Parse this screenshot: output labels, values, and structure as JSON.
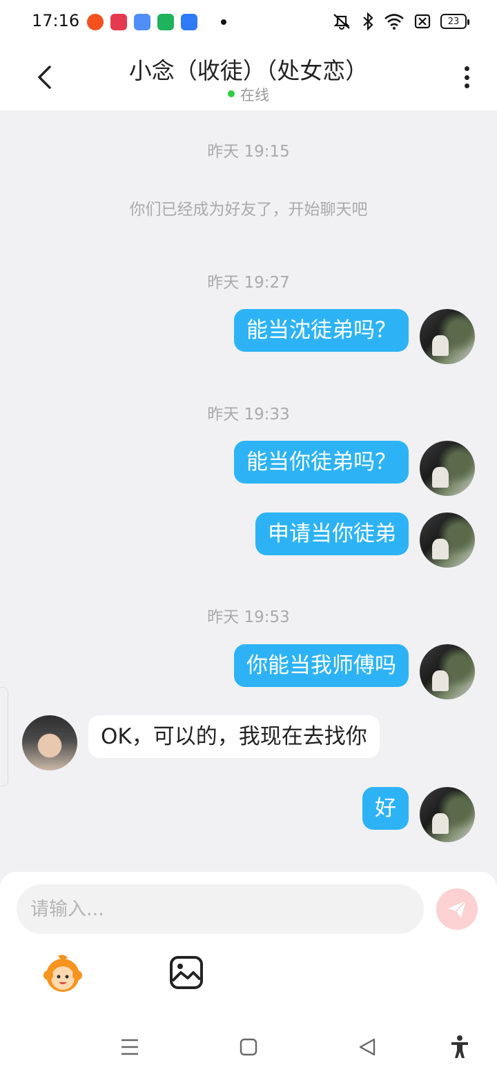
{
  "status_bar": {
    "time": "17:16",
    "battery": "23",
    "app_icons": [
      "weibo-icon",
      "video-icon",
      "feather-icon",
      "shop-icon",
      "files-icon"
    ]
  },
  "header": {
    "title": "小念（收徒）（处女恋）",
    "status": "在线",
    "status_color": "#2ecc40"
  },
  "chat": {
    "system_time": "昨天 19:15",
    "system_message": "你们已经成为好友了，开始聊天吧",
    "time_labels": [
      "昨天 19:27",
      "昨天 19:33",
      "昨天 19:53"
    ],
    "messages": [
      {
        "from": "me",
        "text": "能当沈徒弟吗？"
      },
      {
        "from": "me",
        "text": "能当你徒弟吗？"
      },
      {
        "from": "me",
        "text": "申请当你徒弟"
      },
      {
        "from": "me",
        "text": "你能当我师傅吗"
      },
      {
        "from": "peer",
        "text": "OK，可以的，我现在去找你"
      },
      {
        "from": "me",
        "text": "好"
      }
    ],
    "bubble_color_out": "#2db3f5",
    "bubble_color_in": "#ffffff"
  },
  "input": {
    "placeholder": "请输入..."
  },
  "toolbar": [
    "emoji-icon",
    "image-icon"
  ],
  "nav": [
    "menu-icon",
    "home-icon",
    "back-icon",
    "accessibility-icon"
  ]
}
